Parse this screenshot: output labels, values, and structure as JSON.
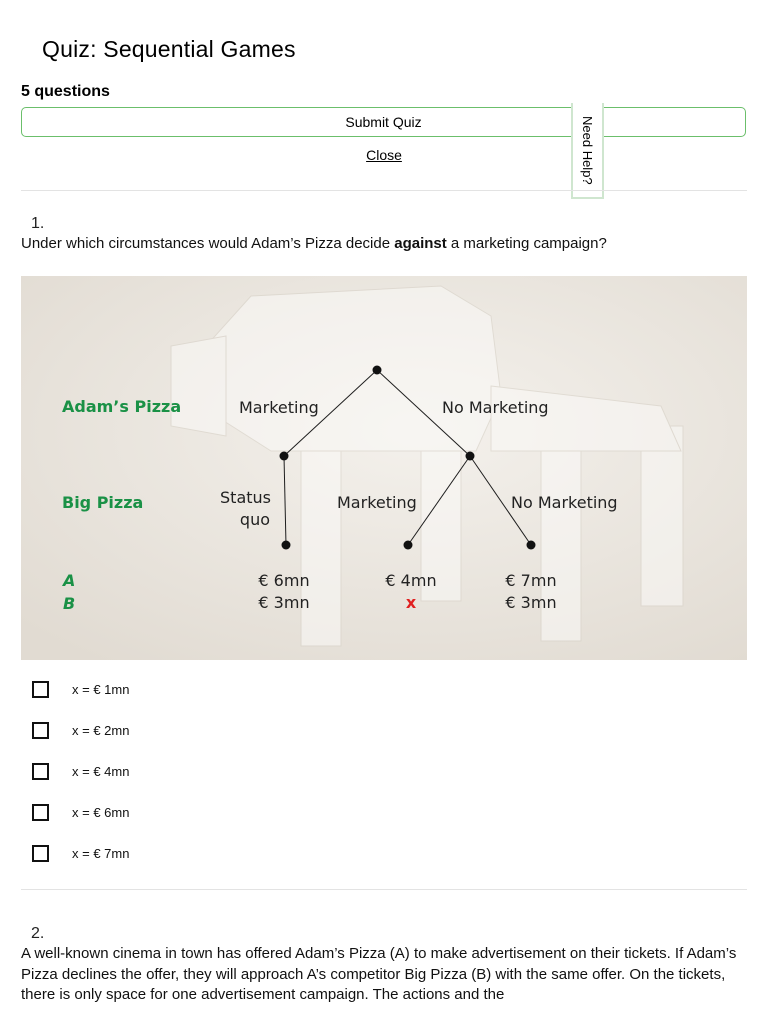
{
  "quiz": {
    "title": "Quiz: Sequential Games",
    "question_count": "5 questions",
    "submit_label": "Submit Quiz",
    "close_label": "Close",
    "help_label": "Need Help?"
  },
  "question1": {
    "number": "1.",
    "text_before": "Under which circumstances would Adam’s Pizza decide ",
    "text_bold": "against",
    "text_after": " a marketing campaign?",
    "figure": {
      "player1": "Adam’s Pizza",
      "player2": "Big Pizza",
      "p1_marketing": "Marketing",
      "p1_no_marketing": "No Marketing",
      "p2_status_quo_line1": "Status",
      "p2_status_quo_line2": "quo",
      "p2_marketing": "Marketing",
      "p2_no_marketing": "No Marketing",
      "row_a": "A",
      "row_b": "B",
      "payoffs": [
        {
          "a": "€ 6mn",
          "b": "€ 3mn"
        },
        {
          "a": "€ 4mn",
          "b": "x"
        },
        {
          "a": "€ 7mn",
          "b": "€ 3mn"
        }
      ],
      "colors": {
        "player": "#1a9146",
        "x": "#e02020",
        "line": "#1e1e1e"
      }
    },
    "options": [
      {
        "label": "x = € 1mn"
      },
      {
        "label": "x = € 2mn"
      },
      {
        "label": "x = € 4mn"
      },
      {
        "label": "x = € 6mn"
      },
      {
        "label": "x = € 7mn"
      }
    ]
  },
  "question2": {
    "number": "2.",
    "text": "A well-known cinema in town has offered Adam’s Pizza (A) to make advertisement on their tickets. If Adam’s Pizza declines the offer, they will approach A’s competitor Big Pizza (B) with the same offer. On the tickets, there is only space for one advertisement campaign. The actions and the"
  }
}
